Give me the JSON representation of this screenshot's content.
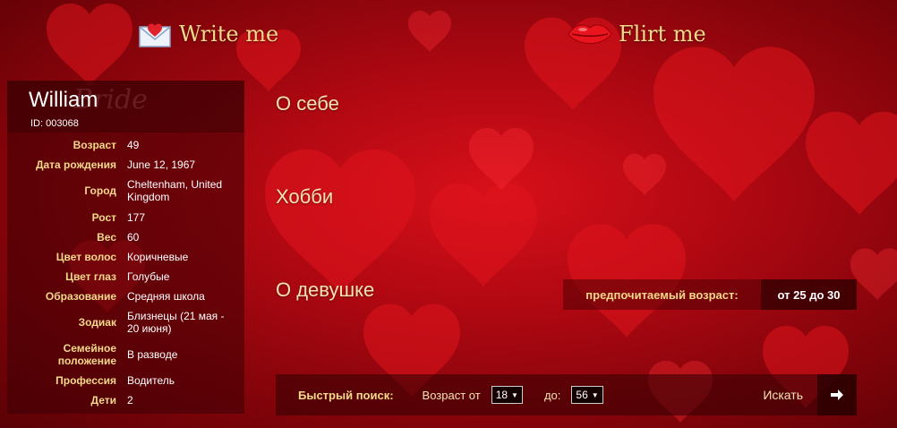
{
  "header": {
    "write_me": "Write me",
    "flirt_me": "Flirt me",
    "write_icon": "envelope-heart-icon",
    "flirt_icon": "lips-icon"
  },
  "profile": {
    "name": "William",
    "id": "ID: 003068",
    "watermark": "Bride",
    "rows": [
      {
        "key": "Возраст",
        "value": "49"
      },
      {
        "key": "Дата рождения",
        "value": "June 12, 1967"
      },
      {
        "key": "Город",
        "value": "Cheltenham, United Kingdom"
      },
      {
        "key": "Рост",
        "value": "177"
      },
      {
        "key": "Вес",
        "value": "60"
      },
      {
        "key": "Цвет волос",
        "value": "Коричневые"
      },
      {
        "key": "Цвет глаз",
        "value": "Голубые"
      },
      {
        "key": "Образование",
        "value": "Средняя школа"
      },
      {
        "key": "Зодиак",
        "value": "Близнецы (21 мая - 20 июня)"
      },
      {
        "key": "Семейное положение",
        "value": "В разводе"
      },
      {
        "key": "Профессия",
        "value": "Водитель"
      },
      {
        "key": "Дети",
        "value": "2"
      }
    ]
  },
  "sections": {
    "about": "О себе",
    "hobby": "Хобби",
    "about_girl": "О девушке"
  },
  "preference": {
    "label": "предпочитаемый возраст:",
    "value": "от 25 до 30"
  },
  "quick_search": {
    "title": "Быстрый поиск:",
    "age_from_label": "Возраст от",
    "age_from_value": "18",
    "age_to_label": "до:",
    "age_to_value": "56",
    "search_label": "Искать",
    "go_icon": "arrow-right-icon"
  },
  "colors": {
    "accent_gold": "#f3d98a",
    "background_red": "#b00812"
  }
}
